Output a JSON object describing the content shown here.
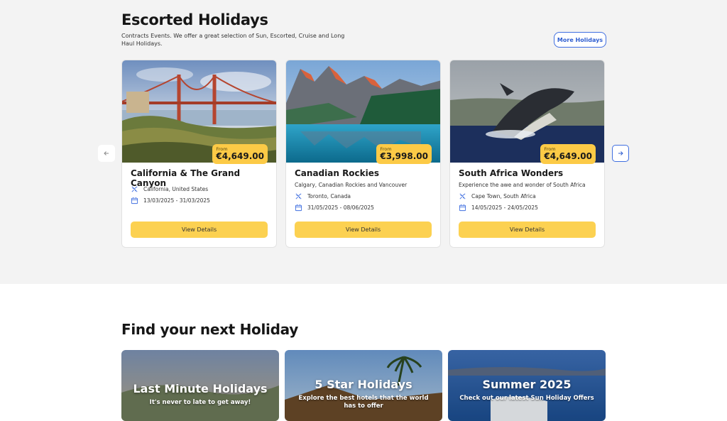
{
  "escorted": {
    "title": "Escorted Holidays",
    "description": "Contracts Events. We offer a great selection of Sun, Escorted, Cruise and Long Haul Holidays.",
    "more_button": "More Holidays",
    "prev_icon": "arrow-left-icon",
    "next_icon": "arrow-right-icon",
    "cards": [
      {
        "title": "California & The Grand Canyon",
        "subtitle": "",
        "location": "California, United States",
        "dates": "13/03/2025 - 31/03/2025",
        "price_from": "From",
        "price": "€4,649.00",
        "button": "View Details"
      },
      {
        "title": "Canadian Rockies",
        "subtitle": "Calgary, Canadian Rockies and Vancouver",
        "location": "Toronto, Canada",
        "dates": "31/05/2025 - 08/06/2025",
        "price_from": "From",
        "price": "€3,998.00",
        "button": "View Details"
      },
      {
        "title": "South Africa Wonders",
        "subtitle": "Experience the awe and wonder of South Africa",
        "location": "Cape Town, South Africa",
        "dates": "14/05/2025 - 24/05/2025",
        "price_from": "From",
        "price": "€4,649.00",
        "button": "View Details"
      }
    ]
  },
  "find": {
    "title": "Find your next Holiday",
    "tiles": [
      {
        "title": "Last Minute Holidays",
        "subtitle": "It's never to late to get away!"
      },
      {
        "title": "5 Star Holidays",
        "subtitle": "Explore the best hotels that the world has to offer"
      },
      {
        "title": "Summer 2025",
        "subtitle": "Check out our latest Sun Holiday Offers"
      }
    ]
  },
  "colors": {
    "accent_blue": "#3f6ee0",
    "price_yellow": "#fcca46",
    "button_yellow": "#fcd151",
    "section_bg": "#f3f3f3"
  }
}
